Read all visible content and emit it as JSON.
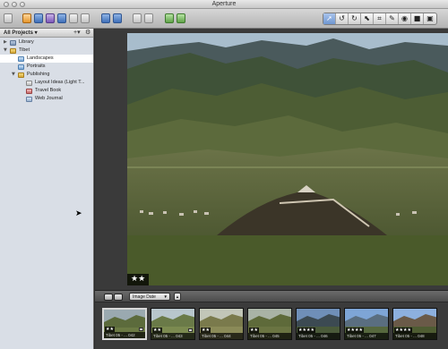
{
  "window": {
    "title": "Aperture"
  },
  "sidebar": {
    "header": "All Projects ▾",
    "add_icon": "+▾",
    "action_icon": "⚙",
    "items": [
      {
        "label": "Library",
        "icon": "library-icon",
        "disclosure": "▶"
      },
      {
        "label": "Tibet",
        "icon": "folder-icon",
        "disclosure": "▼"
      },
      {
        "label": "Landscapes",
        "icon": "project-icon",
        "selected": true
      },
      {
        "label": "Portraits",
        "icon": "project-icon"
      },
      {
        "label": "Publishing",
        "icon": "folder-icon",
        "disclosure": "▼"
      },
      {
        "label": "Layout Ideas (Light T...",
        "icon": "light-table-icon"
      },
      {
        "label": "Travel Book",
        "icon": "book-icon"
      },
      {
        "label": "Web Journal",
        "icon": "web-journal-icon"
      }
    ]
  },
  "viewer": {
    "rating": "★★"
  },
  "browser": {
    "sort_field": "Image Date",
    "sort_dir_symbol": "▴",
    "thumbnails": [
      {
        "caption": "Tibet 05 - ... 042",
        "stars": "★★",
        "has_badge": true
      },
      {
        "caption": "Tibet 05 - ... 043",
        "stars": "★★",
        "has_badge": true
      },
      {
        "caption": "Tibet 05 - ... 044",
        "stars": "★★",
        "has_badge": false
      },
      {
        "caption": "Tibet 05 - ... 045",
        "stars": "★★",
        "has_badge": false
      },
      {
        "caption": "Tibet 05 - ... 046",
        "stars": "★★★★",
        "has_badge": false
      },
      {
        "caption": "Tibet 05 - ... 047",
        "stars": "★★★★",
        "has_badge": false
      },
      {
        "caption": "Tibet 05 - ... 048",
        "stars": "★★★★",
        "has_badge": false
      }
    ]
  }
}
